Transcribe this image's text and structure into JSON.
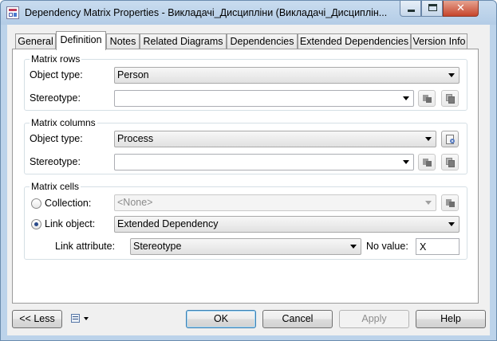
{
  "window": {
    "title": "Dependency Matrix Properties - Викладачі_Дисципліни (Викладачі_Дисциплін..."
  },
  "tabs": [
    {
      "label": "General"
    },
    {
      "label": "Definition"
    },
    {
      "label": "Notes"
    },
    {
      "label": "Related Diagrams"
    },
    {
      "label": "Dependencies"
    },
    {
      "label": "Extended Dependencies"
    },
    {
      "label": "Version Info"
    }
  ],
  "active_tab": "Definition",
  "matrix_rows": {
    "title": "Matrix rows",
    "object_type_label": "Object type:",
    "object_type_value": "Person",
    "stereotype_label": "Stereotype:",
    "stereotype_value": ""
  },
  "matrix_columns": {
    "title": "Matrix columns",
    "object_type_label": "Object type:",
    "object_type_value": "Process",
    "stereotype_label": "Stereotype:",
    "stereotype_value": ""
  },
  "matrix_cells": {
    "title": "Matrix cells",
    "collection_label": "Collection:",
    "collection_value": "<None>",
    "link_object_label": "Link object:",
    "link_object_value": "Extended Dependency",
    "link_attribute_label": "Link attribute:",
    "link_attribute_value": "Stereotype",
    "no_value_label": "No value:",
    "no_value_value": "X",
    "selected_option": "Link object"
  },
  "footer": {
    "less_label": "<< Less",
    "ok_label": "OK",
    "cancel_label": "Cancel",
    "apply_label": "Apply",
    "help_label": "Help"
  },
  "icons": {
    "app": "dependency-matrix-icon",
    "properties": "properties-icon",
    "browse": "browse-icon",
    "copy": "copy-icon",
    "list": "list-icon"
  },
  "colors": {
    "titlebar": "#bcd3ea",
    "close_button": "#c6452b",
    "default_button_border": "#3c7fb1"
  }
}
